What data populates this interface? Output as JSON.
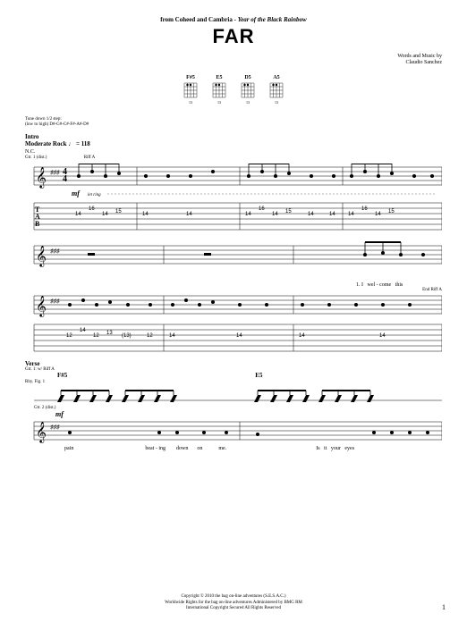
{
  "header": {
    "source_prefix": "from Coheed and Cambria - ",
    "source_album": "Year of the Black Rainbow",
    "title": "FAR",
    "credit_line1": "Words and Music by",
    "credit_line2": "Claudio Sanchez"
  },
  "chords": [
    {
      "name": "F#5",
      "fret": "13"
    },
    {
      "name": "E5",
      "fret": "13"
    },
    {
      "name": "D5",
      "fret": "13"
    },
    {
      "name": "A5",
      "fret": "13"
    }
  ],
  "tuning": {
    "line1": "Tune down 1/2 step:",
    "line2": "(low to high) D#-G#-C#-F#-A#-D#"
  },
  "intro": {
    "label": "Intro",
    "tempo": "Moderate Rock ♩ = 118",
    "nc": "N.C.",
    "gtr": "Gtr. 1 (dist.)",
    "riff": "Riff A",
    "dynamic": "mf",
    "ring": "let ring"
  },
  "tab_system1": {
    "letters": [
      "T",
      "A",
      "B"
    ],
    "frets_row": [
      "14",
      "16",
      "14",
      "15",
      "14",
      "14",
      "14",
      "16",
      "14",
      "15",
      "14",
      "14",
      "14",
      "16",
      "14",
      "15"
    ]
  },
  "system2": {
    "end_riff": "End Riff A",
    "lyric": "1. I   wel - come   this",
    "frets_row": [
      "12",
      "14",
      "12",
      "13",
      "(13)",
      "12",
      "14",
      "14",
      "14",
      "14"
    ]
  },
  "verse": {
    "label": "Verse",
    "gtr1": "Gtr. 1: w/ Riff A",
    "chord_left": "F#5",
    "chord_right": "E5",
    "gtr2": "Gtr. 2 (dist.)",
    "rhy": "Rhy. Fig. 1",
    "dynamic": "mf",
    "lyrics": [
      "pain",
      "beat - ing",
      "down",
      "on",
      "me.",
      "Is   it   your   eyes"
    ]
  },
  "footer": {
    "line1": "Copyright © 2010 the bag on-line adventures (S.E.S.A.C.)",
    "line2": "Worldwide Rights for the bag on-line adventures Administered by BMG RM",
    "line3": "International Copyright Secured   All Rights Reserved"
  },
  "page_number": "1",
  "chart_data": {
    "type": "table",
    "title": "Guitar Tablature — FAR",
    "tuning": "D#-G#-C#-F#-A#-D# (half-step down)",
    "tempo_bpm": 118,
    "sections": [
      {
        "name": "Intro Riff A (system 1)",
        "tab_frets": [
          14,
          16,
          14,
          15,
          14,
          14,
          14,
          16,
          14,
          15,
          14,
          14,
          14,
          16,
          14,
          15
        ]
      },
      {
        "name": "Intro Riff A (system 2)",
        "tab_frets": [
          12,
          14,
          12,
          13,
          13,
          12,
          14,
          14,
          14,
          14
        ]
      }
    ],
    "chord_diagrams": [
      {
        "name": "F#5",
        "position": 13
      },
      {
        "name": "E5",
        "position": 13
      },
      {
        "name": "D5",
        "position": 13
      },
      {
        "name": "A5",
        "position": 13
      }
    ]
  }
}
